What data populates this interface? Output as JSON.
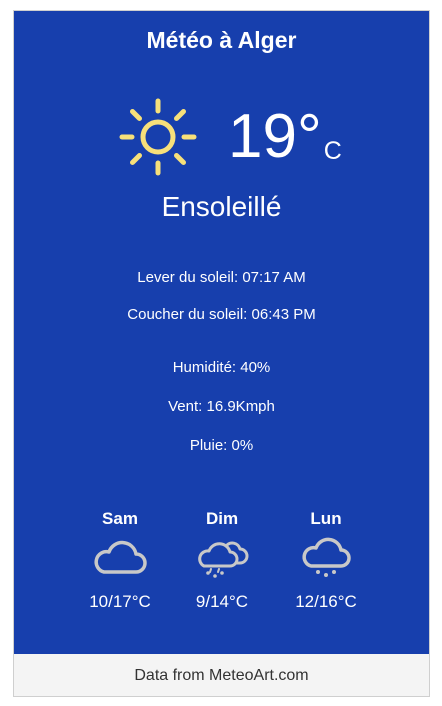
{
  "widget": {
    "title": "Météo à Alger",
    "current": {
      "icon": "sun-icon",
      "temperature": "19°",
      "unit": "C",
      "condition": "Ensoleillé"
    },
    "sunrise": "Lever du soleil: 07:17 AM",
    "sunset": "Coucher du soleil: 06:43 PM",
    "humidity": "Humidité: 40%",
    "wind": "Vent: 16.9Kmph",
    "rain": "Pluie: 0%",
    "forecast": [
      {
        "day": "Sam",
        "icon": "cloud-icon",
        "temps": "10/17°C"
      },
      {
        "day": "Dim",
        "icon": "cloud-rain-snow-icon",
        "temps": "9/14°C"
      },
      {
        "day": "Lun",
        "icon": "cloud-rain-icon",
        "temps": "12/16°C"
      }
    ],
    "footer": {
      "prefix": "Data from ",
      "link": "MeteoArt.com"
    },
    "colors": {
      "background": "#173fad",
      "sun": "#f7e07a",
      "forecast_icon": "#c8c8c8",
      "footer_bg": "#f4f4f4"
    }
  }
}
